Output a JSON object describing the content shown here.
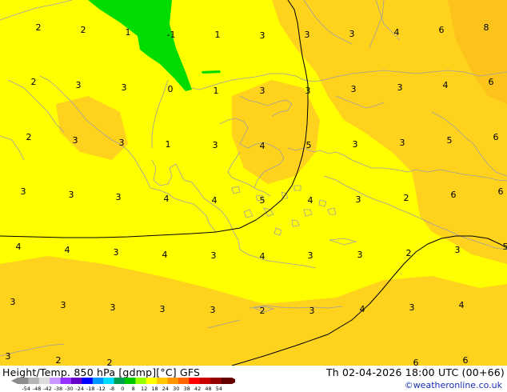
{
  "header": {
    "title_left": "Height/Temp. 850 hPa [gdmp][°C] GFS",
    "title_right": "Th 02-04-2026 18:00 UTC (00+66)",
    "credit": "©weatheronline.co.uk"
  },
  "legend": {
    "ticks": [
      "-54",
      "-48",
      "-42",
      "-38",
      "-30",
      "-24",
      "-18",
      "-12",
      "-8",
      "0",
      "8",
      "12",
      "18",
      "24",
      "30",
      "38",
      "42",
      "48",
      "54"
    ],
    "colors": [
      "#8c8c8c",
      "#b4b4b4",
      "#dcdcdc",
      "#c896ff",
      "#9632ff",
      "#6400c8",
      "#0000ff",
      "#0096ff",
      "#00dcff",
      "#00a050",
      "#00c800",
      "#96ff00",
      "#ffff00",
      "#ffc800",
      "#ff9600",
      "#ff6400",
      "#ff0000",
      "#c80000",
      "#960000",
      "#640000"
    ]
  },
  "map": {
    "colors": {
      "base": "#ffff00",
      "warm": "#ffd21e",
      "warmer": "#fcc41a",
      "green": "#00dc00",
      "coast": "#a0a0a0",
      "contour": "#000000"
    },
    "labels": [
      {
        "t": "2"
      },
      {
        "t": "2"
      },
      {
        "t": "1"
      },
      {
        "t": "-1"
      },
      {
        "t": "1"
      },
      {
        "t": "3"
      },
      {
        "t": "3"
      },
      {
        "t": "3"
      },
      {
        "t": "4"
      },
      {
        "t": "6"
      },
      {
        "t": "8"
      },
      {
        "t": "2"
      },
      {
        "t": "3"
      },
      {
        "t": "3"
      },
      {
        "t": "0"
      },
      {
        "t": "1"
      },
      {
        "t": "3"
      },
      {
        "t": "3"
      },
      {
        "t": "3"
      },
      {
        "t": "3"
      },
      {
        "t": "4"
      },
      {
        "t": "6"
      },
      {
        "t": "2"
      },
      {
        "t": "3"
      },
      {
        "t": "3"
      },
      {
        "t": "1"
      },
      {
        "t": "3"
      },
      {
        "t": "4"
      },
      {
        "t": "5"
      },
      {
        "t": "3"
      },
      {
        "t": "3"
      },
      {
        "t": "5"
      },
      {
        "t": "6"
      },
      {
        "t": "3"
      },
      {
        "t": "3"
      },
      {
        "t": "3"
      },
      {
        "t": "4"
      },
      {
        "t": "4"
      },
      {
        "t": "5"
      },
      {
        "t": "4"
      },
      {
        "t": "3"
      },
      {
        "t": "2"
      },
      {
        "t": "6"
      },
      {
        "t": "6"
      },
      {
        "t": "4"
      },
      {
        "t": "4"
      },
      {
        "t": "3"
      },
      {
        "t": "4"
      },
      {
        "t": "3"
      },
      {
        "t": "4"
      },
      {
        "t": "3"
      },
      {
        "t": "3"
      },
      {
        "t": "2"
      },
      {
        "t": "3"
      },
      {
        "t": "5"
      },
      {
        "t": "3"
      },
      {
        "t": "3"
      },
      {
        "t": "3"
      },
      {
        "t": "3"
      },
      {
        "t": "3"
      },
      {
        "t": "2"
      },
      {
        "t": "3"
      },
      {
        "t": "4"
      },
      {
        "t": "3"
      },
      {
        "t": "4"
      },
      {
        "t": "3"
      },
      {
        "t": "2"
      },
      {
        "t": "2"
      },
      {
        "t": "6"
      },
      {
        "t": "6"
      }
    ]
  }
}
